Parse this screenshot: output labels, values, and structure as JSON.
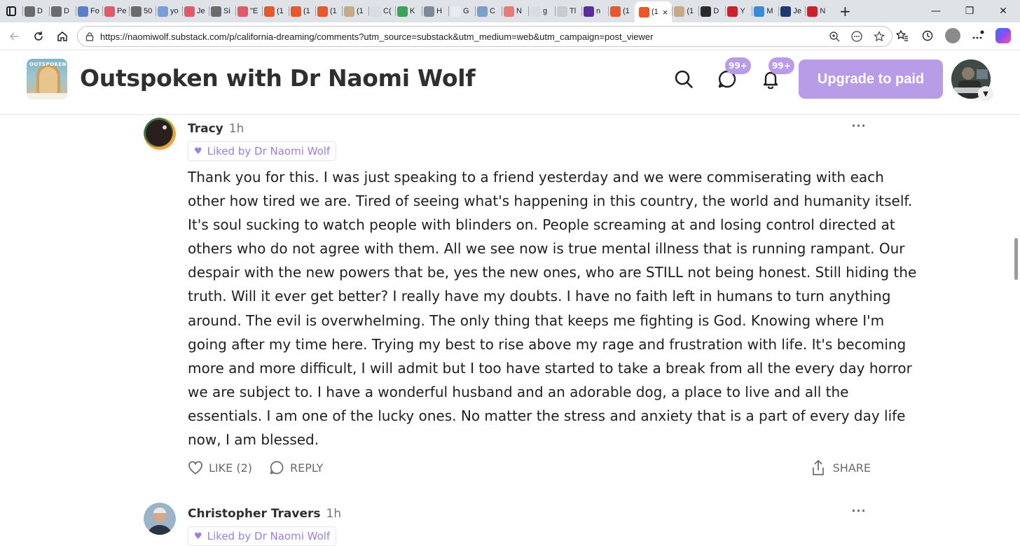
{
  "browser": {
    "tabs": [
      {
        "label": "D",
        "fav": "#6b6b6b"
      },
      {
        "label": "D",
        "fav": "#6b6b6b"
      },
      {
        "label": "Fo",
        "fav": "#5a7ec9"
      },
      {
        "label": "Pe",
        "fav": "#e05a6a"
      },
      {
        "label": "50",
        "fav": "#6b6b6b"
      },
      {
        "label": "yo",
        "fav": "#7a9fd8"
      },
      {
        "label": "Je",
        "fav": "#e05a6a"
      },
      {
        "label": "Si",
        "fav": "#6b6b6b"
      },
      {
        "label": "\"E",
        "fav": "#e05a6a"
      },
      {
        "label": "(1",
        "fav": "#e8582a"
      },
      {
        "label": "(1",
        "fav": "#e8582a"
      },
      {
        "label": "(1",
        "fav": "#e8582a"
      },
      {
        "label": "(1",
        "fav": "#c7a98a"
      },
      {
        "label": "C(",
        "fav": "#d8dde3"
      },
      {
        "label": "K",
        "fav": "#3aa55a"
      },
      {
        "label": "H",
        "fav": "#7b8a9a"
      },
      {
        "label": "G",
        "fav": "#e8ecf0"
      },
      {
        "label": "C",
        "fav": "#7ba0c8"
      },
      {
        "label": "N",
        "fav": "#e87a7a"
      },
      {
        "label": "g",
        "fav": "#d8dde3"
      },
      {
        "label": "Tl",
        "fav": "#c8ccd0"
      },
      {
        "label": "n",
        "fav": "#5b2c9e"
      },
      {
        "label": "(1",
        "fav": "#e8582a"
      }
    ],
    "active_tab": {
      "label": "(1",
      "close": "×",
      "fav": "#e8582a"
    },
    "tabs_after": [
      {
        "label": "(1",
        "fav": "#c7a98a"
      },
      {
        "label": "D",
        "fav": "#2b2b2b"
      },
      {
        "label": "Y",
        "fav": "#c8232c"
      },
      {
        "label": "M",
        "fav": "#3a8ad8"
      },
      {
        "label": "Je",
        "fav": "#1d3b6e"
      },
      {
        "label": "N",
        "fav": "#c8232c"
      }
    ],
    "url": "https://naomiwolf.substack.com/p/california-dreaming/comments?utm_source=substack&utm_medium=web&utm_campaign=post_viewer"
  },
  "publication": {
    "title": "Outspoken with Dr Naomi Wolf",
    "logo_text": "OUTSPOKEN",
    "chat_badge": "99+",
    "notif_badge": "99+",
    "upgrade_label": "Upgrade to paid"
  },
  "comments": [
    {
      "author": "Tracy",
      "time": "1h",
      "liked_by": "Liked by Dr Naomi Wolf",
      "body_lines": [
        "Thank you for this. I was just speaking to a friend yesterday and we were commiserating with each",
        "other how tired we are. Tired of seeing what's happening in this country, the world and humanity itself.",
        "It's soul sucking to watch people with blinders on. People screaming at and losing control directed at",
        "others who do not agree with them. All we see now is true mental illness that is running rampant. Our",
        "despair with the new powers that be, yes the new ones, who are STILL not being honest. Still hiding the",
        "truth. Will it ever get better? I really have my doubts. I have no faith left in humans to turn anything",
        "around. The evil is overwhelming. The only thing that keeps me fighting is God. Knowing where I'm",
        "going after my time here. Trying my best to rise above my rage and frustration with life. It's becoming",
        "more and more difficult, I will admit but I too have started to take a break from all the every day horror",
        "we are subject to. I have a wonderful husband and an adorable dog, a place to live and all the",
        "essentials. I am one of the lucky ones. No matter the stress and anxiety that is a part of every day life",
        "now, I am blessed."
      ],
      "like_label": "LIKE (2)",
      "reply_label": "REPLY",
      "share_label": "SHARE"
    },
    {
      "author": "Christopher Travers",
      "time": "1h",
      "liked_by": "Liked by Dr Naomi Wolf"
    }
  ]
}
